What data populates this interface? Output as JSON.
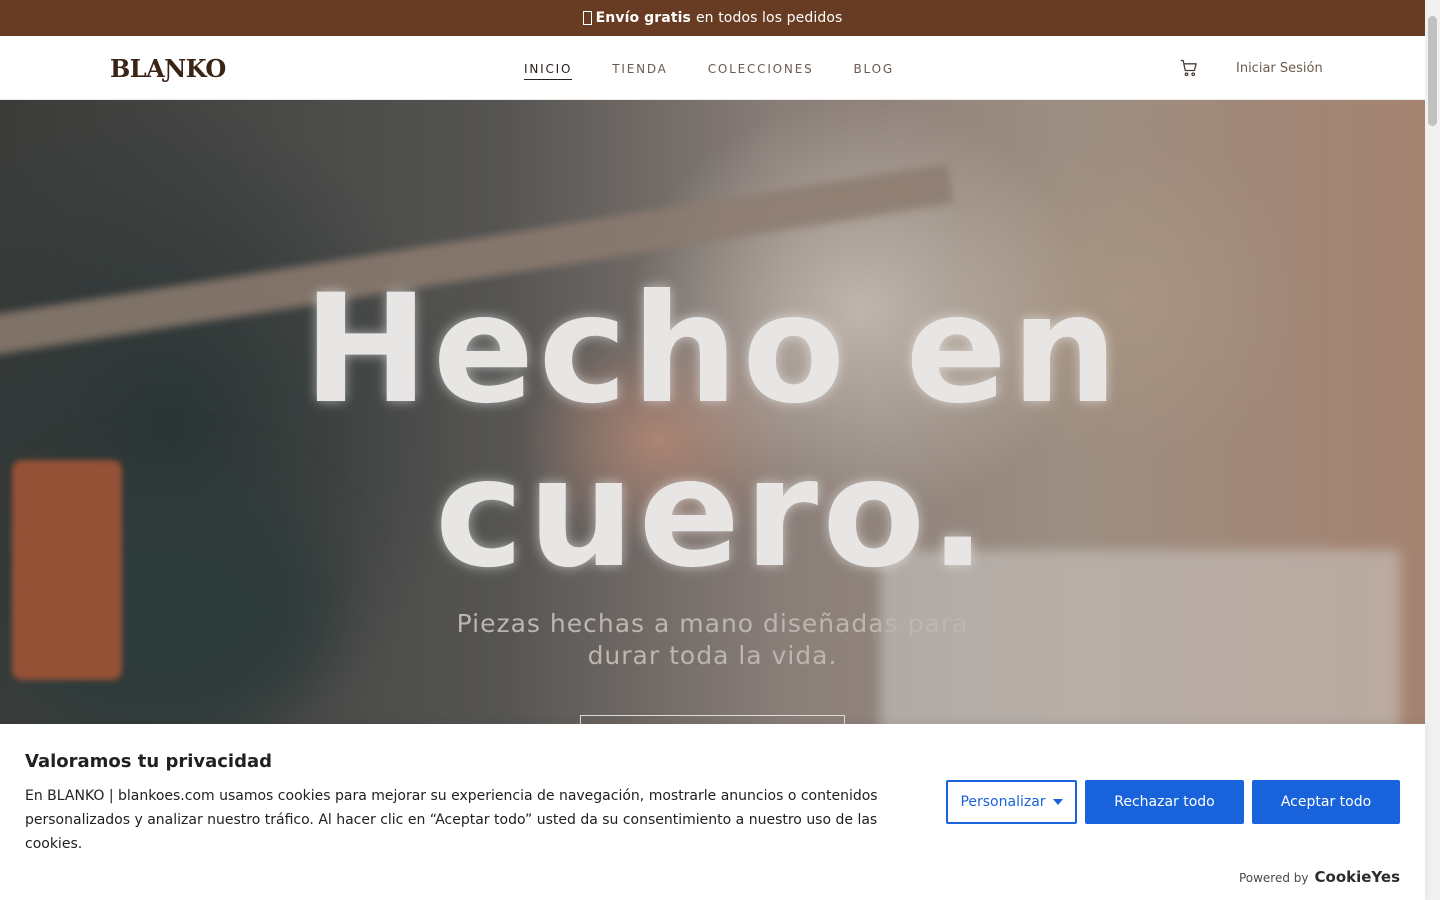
{
  "announcement": {
    "icon": "gift-icon",
    "bold_text": "Envío gratis",
    "text": "en todos los pedidos",
    "background": "#673c22"
  },
  "header": {
    "logo": "BLAƝKO",
    "nav": [
      {
        "label": "INICIO",
        "active": true
      },
      {
        "label": "TIENDA",
        "active": false
      },
      {
        "label": "COLECCIONES",
        "active": false
      },
      {
        "label": "BLOG",
        "active": false
      }
    ],
    "cart_icon": "cart-icon",
    "login_label": "Iniciar Sesión"
  },
  "hero": {
    "title_line1": "Hecho en",
    "title_line2": "cuero.",
    "subtitle": "Piezas hechas a mano diseñadas para durar toda la vida."
  },
  "cookie_banner": {
    "title": "Valoramos tu privacidad",
    "text": "En BLANKO | blankoes.com usamos cookies para mejorar su experiencia de navegación, mostrarle anuncios o contenidos personalizados y analizar nuestro tráfico. Al hacer clic en “Aceptar todo” usted da su consentimiento a nuestro uso de las cookies.",
    "customize_label": "Personalizar",
    "reject_label": "Rechazar todo",
    "accept_label": "Aceptar todo",
    "powered_by": "Powered by",
    "powered_brand": "CookieYes",
    "accent": "#1863dc"
  }
}
